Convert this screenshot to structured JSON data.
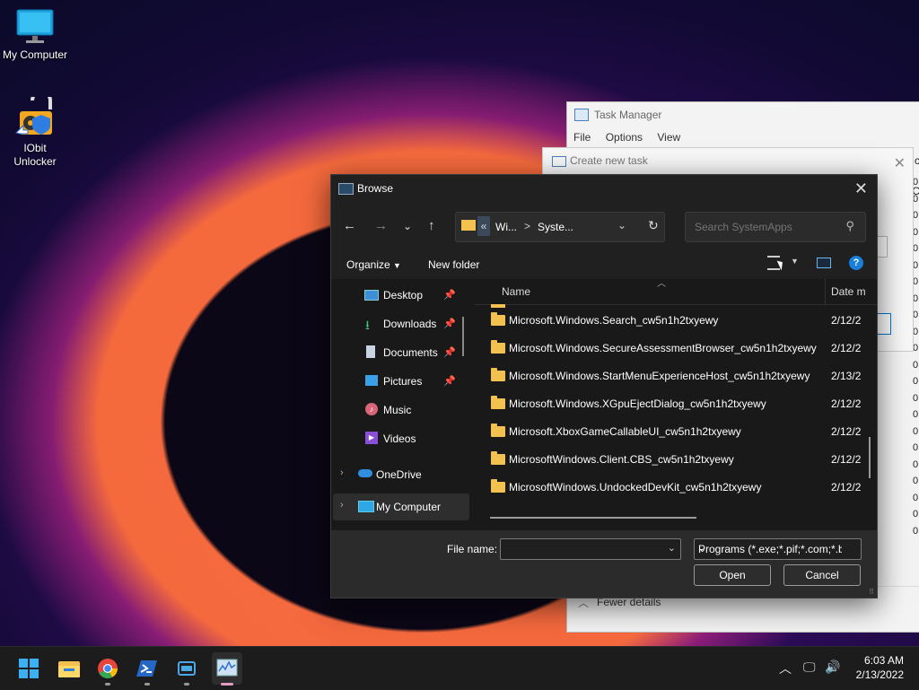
{
  "desktop": {
    "icons": [
      {
        "label": "My Computer"
      },
      {
        "label": "IObit Unlocker"
      }
    ]
  },
  "task_manager": {
    "title": "Task Manager",
    "menu": [
      "File",
      "Options",
      "View"
    ],
    "fewer_details": "Fewer details",
    "edge_letter": "c",
    "edge_letter2": "C",
    "col_values": [
      "0",
      "0",
      "0",
      "0",
      "0",
      "0",
      "0",
      "0",
      "0",
      "0",
      "0",
      "0",
      "0",
      "0",
      "0",
      "0",
      "0",
      "0",
      "0",
      "0",
      "0",
      "0"
    ]
  },
  "create_task": {
    "title": "Create new task"
  },
  "browse": {
    "title": "Browse",
    "address": {
      "overflow": "«",
      "seg1": "Wi...",
      "sep": ">",
      "seg2": "Syste..."
    },
    "search_placeholder": "Search SystemApps",
    "toolbar": {
      "organize": "Organize",
      "new_folder": "New folder"
    },
    "nav": [
      {
        "label": "Desktop",
        "pinned": true
      },
      {
        "label": "Downloads",
        "pinned": true
      },
      {
        "label": "Documents",
        "pinned": true
      },
      {
        "label": "Pictures",
        "pinned": true
      },
      {
        "label": "Music",
        "pinned": false
      },
      {
        "label": "Videos",
        "pinned": false
      },
      {
        "label": "OneDrive",
        "pinned": false
      },
      {
        "label": "My Computer",
        "pinned": false
      }
    ],
    "columns": {
      "name": "Name",
      "date": "Date m"
    },
    "files": [
      {
        "name": "Microsoft.Windows.Search_cw5n1h2txyewy",
        "date": "2/12/2"
      },
      {
        "name": "Microsoft.Windows.SecureAssessmentBrowser_cw5n1h2txyewy",
        "date": "2/12/2"
      },
      {
        "name": "Microsoft.Windows.StartMenuExperienceHost_cw5n1h2txyewy",
        "date": "2/13/2"
      },
      {
        "name": "Microsoft.Windows.XGpuEjectDialog_cw5n1h2txyewy",
        "date": "2/12/2"
      },
      {
        "name": "Microsoft.XboxGameCallableUI_cw5n1h2txyewy",
        "date": "2/12/2"
      },
      {
        "name": "MicrosoftWindows.Client.CBS_cw5n1h2txyewy",
        "date": "2/12/2"
      },
      {
        "name": "MicrosoftWindows.UndockedDevKit_cw5n1h2txyewy",
        "date": "2/12/2"
      }
    ],
    "file_name_label": "File name:",
    "file_name_value": "",
    "file_type": "Programs (*.exe;*.pif;*.com;*.bat;*.cmd)",
    "open_label": "Open",
    "cancel_label": "Cancel"
  },
  "taskbar": {
    "clock_time": "6:03 AM",
    "clock_date": "2/13/2022"
  },
  "colors": {
    "dialog_bg": "#202020",
    "folder": "#f2c14e",
    "accent": "#0078d4"
  }
}
